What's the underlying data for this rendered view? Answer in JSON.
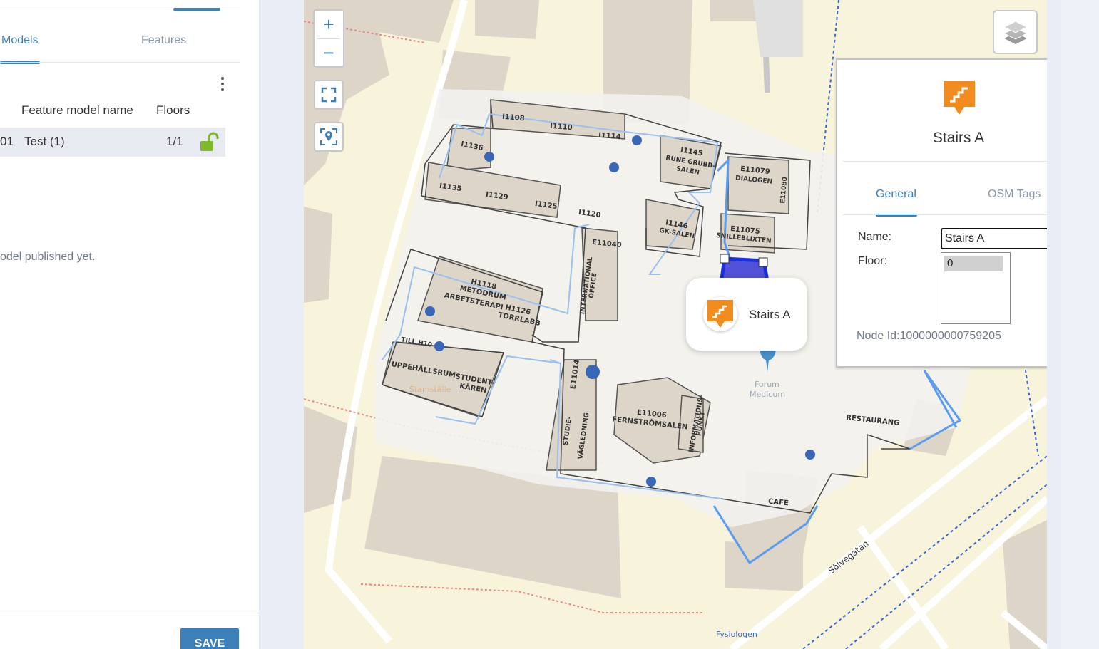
{
  "sidebar": {
    "tabs": [
      {
        "label": "Models",
        "active": true
      },
      {
        "label": "Features",
        "active": false
      }
    ],
    "table": {
      "columns": [
        "Feature model name",
        "Floors"
      ],
      "rows": [
        {
          "id_fragment": "01",
          "name": "Test (1)",
          "floors": "1/1",
          "locked": false
        }
      ]
    },
    "empty_message": "odel published yet.",
    "save_label": "SAVE"
  },
  "map": {
    "controls": {
      "zoom_in": "+",
      "zoom_out": "−"
    },
    "rooms": [
      {
        "label": "I1108"
      },
      {
        "label": "I1110"
      },
      {
        "label": "I1114"
      },
      {
        "label": "I1136"
      },
      {
        "label": "I1145"
      },
      {
        "label": "RUNE GRUBB-"
      },
      {
        "label": "SALEN"
      },
      {
        "label": "E11079"
      },
      {
        "label": "DIALOGEN"
      },
      {
        "label": "E11080"
      },
      {
        "label": "I1135"
      },
      {
        "label": "I1129"
      },
      {
        "label": "I1125"
      },
      {
        "label": "I1120"
      },
      {
        "label": "I1146"
      },
      {
        "label": "GK-SALEN"
      },
      {
        "label": "E11075"
      },
      {
        "label": "SNILLEBLIXTEN"
      },
      {
        "label": "E11040"
      },
      {
        "label": "H1118"
      },
      {
        "label": "METODRUM"
      },
      {
        "label": "ARBETSTERAPI"
      },
      {
        "label": "H1126"
      },
      {
        "label": "TORRLABB"
      },
      {
        "label": "INTERNATIONAL"
      },
      {
        "label": "OFFICE"
      },
      {
        "label": "TILL H10"
      },
      {
        "label": "UPPEHÅLLSRUM"
      },
      {
        "label": "STUDENT-"
      },
      {
        "label": "KÅREN"
      },
      {
        "label": "E11014"
      },
      {
        "label": "E11006"
      },
      {
        "label": "FERNSTRÖMSALEN"
      },
      {
        "label": "INFORMATIONS-"
      },
      {
        "label": "PUNKT"
      },
      {
        "label": "STUDIE-"
      },
      {
        "label": "VÄGLEDNING"
      },
      {
        "label": "RESTAURANG"
      },
      {
        "label": "CAFÉ"
      },
      {
        "label": "Forum"
      },
      {
        "label": "Medicum"
      },
      {
        "label": "Stamställe"
      }
    ],
    "streets": [
      {
        "label": "Sölvegatan"
      },
      {
        "label": "Fysiologen"
      }
    ],
    "tooltip": {
      "label": "Stairs A"
    },
    "popup": {
      "title": "Stairs A",
      "tabs": [
        {
          "label": "General",
          "active": true
        },
        {
          "label": "OSM Tags",
          "active": false
        }
      ],
      "name_label": "Name:",
      "name_value": "Stairs A",
      "floor_label": "Floor:",
      "floor_options": [
        "0"
      ],
      "node_id": "Node Id:1000000000759205"
    }
  },
  "colors": {
    "accent": "#3d7fb8",
    "stairs_orange": "#f28c1e",
    "lock_green": "#7fb82a",
    "building": "#ddd5c8",
    "indoor_floor": "#f2f1ee",
    "outline_blue": "#3a86e0"
  }
}
